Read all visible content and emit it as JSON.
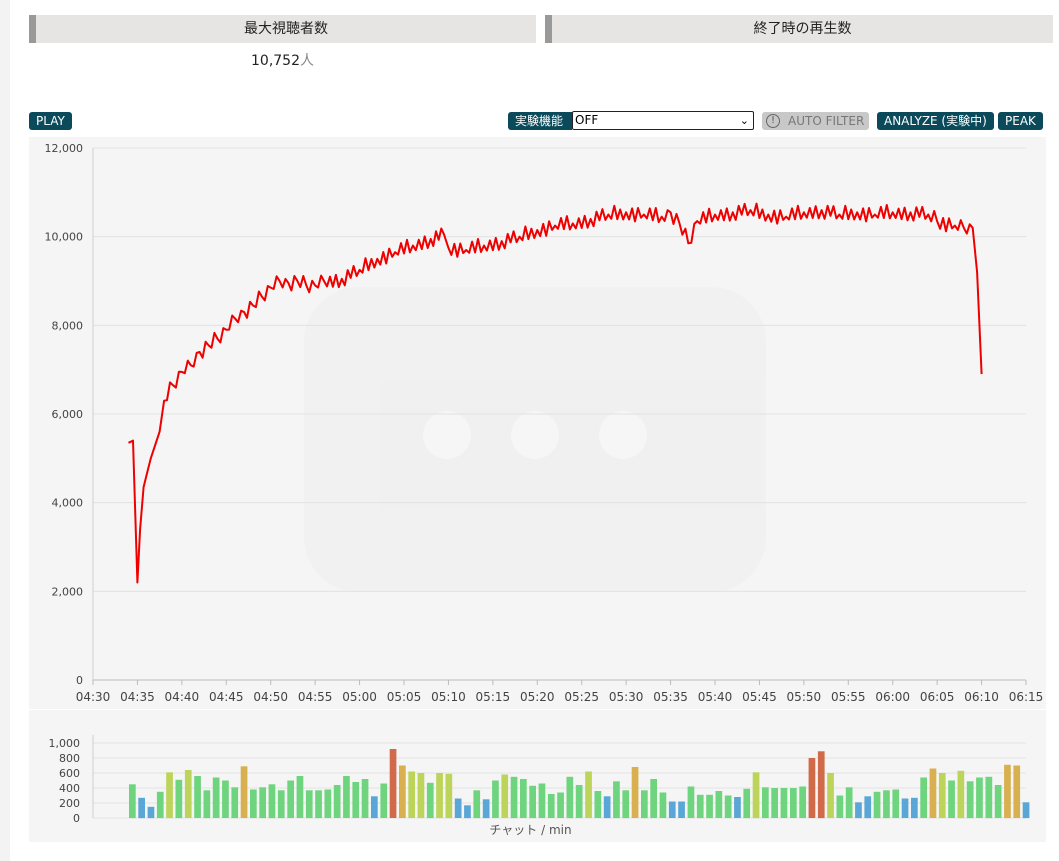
{
  "stats": [
    {
      "label": "最大視聴者数",
      "value": "10,752",
      "unit": "人"
    },
    {
      "label": "終了時の再生数",
      "value": "",
      "unit": ""
    }
  ],
  "toolbar": {
    "play": "PLAY",
    "experimental_label": "実験機能",
    "experimental_value": "OFF",
    "auto_filter": "AUTO FILTER",
    "analyze": "ANALYZE (実験中)",
    "peak": "PEAK"
  },
  "colors": {
    "line": "#ee0000",
    "button": "#0b4a5a",
    "bar_low": "#5aa6d6",
    "bar_mid": "#6fd47e",
    "bar_yellow": "#bcd45a",
    "bar_orange": "#d8b050",
    "bar_high": "#d06a48"
  },
  "chart_data": [
    {
      "type": "line",
      "title": "",
      "xlabel": "",
      "ylabel": "",
      "xlim": [
        "04:30",
        "06:15"
      ],
      "ylim": [
        0,
        12000
      ],
      "y_ticks": [
        "0",
        "2,000",
        "4,000",
        "6,000",
        "8,000",
        "10,000",
        "12,000"
      ],
      "x_ticks": [
        "04:30",
        "04:35",
        "04:40",
        "04:45",
        "04:50",
        "04:55",
        "05:00",
        "05:05",
        "05:10",
        "05:15",
        "05:20",
        "05:25",
        "05:30",
        "05:35",
        "05:40",
        "05:45",
        "05:50",
        "05:55",
        "06:00",
        "06:05",
        "06:10",
        "06:15"
      ],
      "grid": true,
      "series": [
        {
          "name": "",
          "x": [
            "04:34",
            "04:34.5",
            "04:35",
            "04:35.3",
            "04:35.7",
            "04:36",
            "04:36.5",
            "04:37",
            "04:37.5",
            "04:38",
            "04:39",
            "04:40",
            "04:41",
            "04:42",
            "04:43",
            "04:44",
            "04:45",
            "04:46",
            "04:47",
            "04:48",
            "04:49",
            "04:50",
            "04:51",
            "04:52",
            "04:53",
            "04:54",
            "04:55",
            "04:56",
            "04:58",
            "05:00",
            "05:02",
            "05:04",
            "05:06",
            "05:08",
            "05:09.5",
            "05:10",
            "05:12",
            "05:14",
            "05:16",
            "05:18",
            "05:20",
            "05:22",
            "05:24",
            "05:26",
            "05:28",
            "05:30",
            "05:32",
            "05:34",
            "05:35",
            "05:36",
            "05:37",
            "05:38",
            "05:40",
            "05:42",
            "05:44",
            "05:46",
            "05:48",
            "05:50",
            "05:52",
            "05:54",
            "05:56",
            "05:58",
            "06:00",
            "06:02",
            "06:04",
            "06:05",
            "06:07",
            "06:08",
            "06:09",
            "06:09.5",
            "06:10"
          ],
          "y": [
            5350,
            5400,
            2200,
            3400,
            4350,
            4600,
            5000,
            5300,
            5600,
            6300,
            6650,
            6950,
            7100,
            7400,
            7550,
            7700,
            7900,
            8150,
            8300,
            8450,
            8650,
            8850,
            9000,
            8950,
            9000,
            8900,
            8900,
            9000,
            9050,
            9250,
            9500,
            9650,
            9800,
            9950,
            10050,
            9750,
            9700,
            9800,
            9900,
            10000,
            10150,
            10250,
            10300,
            10400,
            10500,
            10550,
            10500,
            10450,
            10550,
            10300,
            9850,
            10350,
            10500,
            10550,
            10600,
            10500,
            10450,
            10550,
            10600,
            10500,
            10550,
            10500,
            10550,
            10550,
            10500,
            10350,
            10250,
            10200,
            10200,
            9200,
            6900
          ]
        }
      ]
    },
    {
      "type": "bar",
      "title": "",
      "xlabel": "チャット / min",
      "ylabel": "",
      "ylim": [
        0,
        1000
      ],
      "y_ticks": [
        "0",
        "200",
        "400",
        "600",
        "800",
        "1,000"
      ],
      "grid": true,
      "values": [
        450,
        270,
        150,
        350,
        610,
        510,
        640,
        560,
        370,
        540,
        500,
        410,
        690,
        380,
        410,
        450,
        370,
        500,
        560,
        370,
        370,
        380,
        440,
        560,
        480,
        520,
        290,
        460,
        920,
        700,
        620,
        600,
        470,
        600,
        590,
        260,
        170,
        370,
        250,
        500,
        580,
        550,
        520,
        430,
        460,
        320,
        340,
        550,
        440,
        620,
        360,
        290,
        490,
        370,
        680,
        370,
        520,
        340,
        220,
        220,
        420,
        310,
        310,
        360,
        300,
        280,
        390,
        610,
        410,
        400,
        400,
        400,
        420,
        800,
        890,
        600,
        300,
        410,
        210,
        290,
        350,
        370,
        380,
        260,
        270,
        540,
        660,
        600,
        500,
        630,
        490,
        540,
        550,
        440,
        710,
        700,
        210
      ]
    }
  ]
}
